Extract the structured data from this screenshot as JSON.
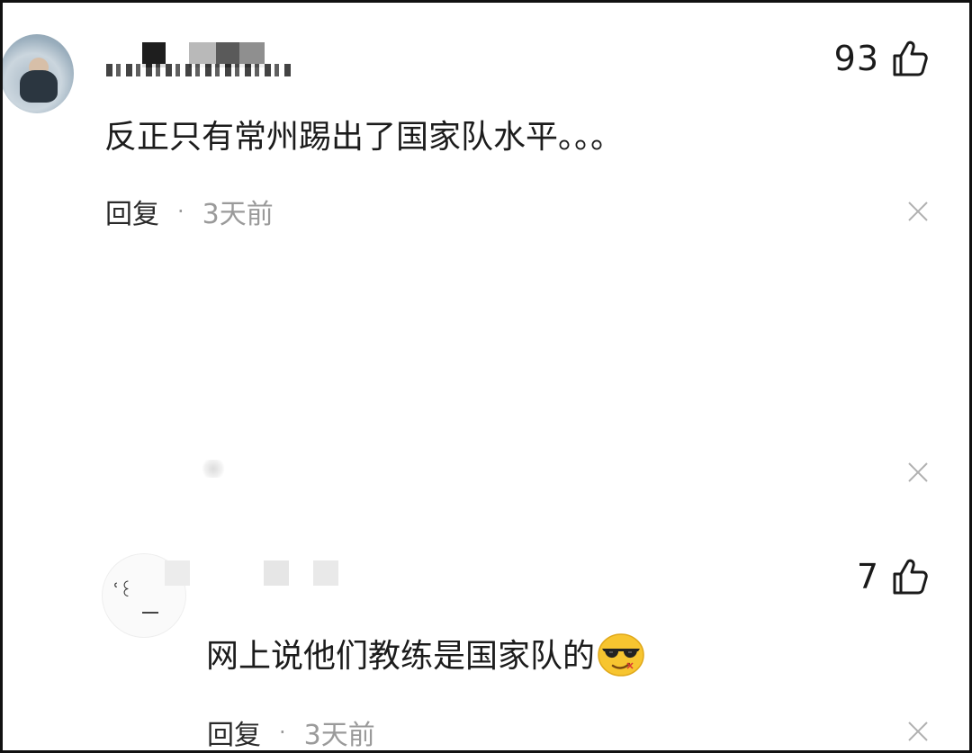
{
  "comments": [
    {
      "like_count": "93",
      "text": "反正只有常州踢出了国家队水平。。。",
      "reply_label": "回复",
      "separator": "·",
      "time": "3天前"
    },
    {
      "like_count": "7",
      "text": "网上说他们教练是国家队的",
      "emoji_name": "sunglasses-emoji",
      "reply_label": "回复",
      "separator": "·",
      "time": "3天前"
    }
  ],
  "icons": {
    "like": "thumbs-up-icon",
    "dismiss": "close-icon"
  },
  "colors": {
    "text": "#1a1a1a",
    "meta": "#9a9a9a",
    "border": "#111111"
  }
}
